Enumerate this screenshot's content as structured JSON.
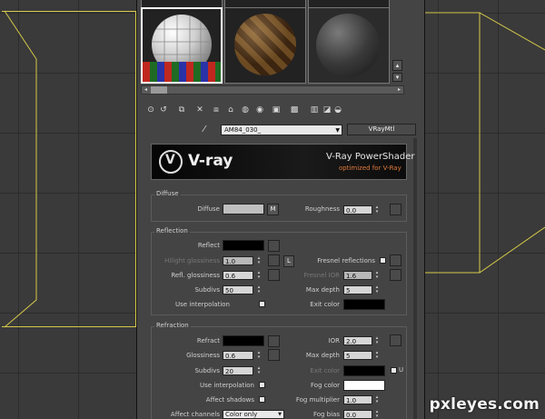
{
  "material": {
    "name": "AM84_030_",
    "type": "VRayMtl"
  },
  "banner": {
    "logo_text": "V-ray",
    "title": "V-Ray PowerShader",
    "subtitle": "optimized for V-Ray"
  },
  "diffuse": {
    "group_title": "Diffuse",
    "diffuse_label": "Diffuse",
    "map_button": "M",
    "roughness_label": "Roughness",
    "roughness_value": "0.0"
  },
  "reflection": {
    "group_title": "Reflection",
    "reflect_label": "Reflect",
    "hilight_label": "Hilight glossiness",
    "hilight_value": "1.0",
    "lock_button": "L",
    "fresnel_label": "Fresnel reflections",
    "refl_gloss_label": "Refl. glossiness",
    "refl_gloss_value": "0.6",
    "fresnel_ior_label": "Fresnel IOR",
    "fresnel_ior_value": "1.6",
    "subdivs_label": "Subdivs",
    "subdivs_value": "50",
    "max_depth_label": "Max depth",
    "max_depth_value": "5",
    "interp_label": "Use interpolation",
    "exit_color_label": "Exit color"
  },
  "refraction": {
    "group_title": "Refraction",
    "refract_label": "Refract",
    "ior_label": "IOR",
    "ior_value": "2.0",
    "gloss_label": "Glossiness",
    "gloss_value": "0.6",
    "max_depth_label": "Max depth",
    "max_depth_value": "5",
    "subdivs_label": "Subdivs",
    "subdivs_value": "20",
    "exit_color_label": "Exit color",
    "exit_u_label": "U",
    "interp_label": "Use interpolation",
    "fog_color_label": "Fog color",
    "affect_shadows_label": "Affect shadows",
    "fog_mult_label": "Fog multiplier",
    "fog_mult_value": "1.0",
    "affect_channels_label": "Affect channels",
    "affect_channels_value": "Color only",
    "fog_bias_label": "Fog bias",
    "fog_bias_value": "0.0"
  },
  "colors": {
    "viewport_bg": "#3a3a3a",
    "wireframe": "#d6c94a",
    "panel_bg": "#444444",
    "banner_accent": "#c0392b"
  },
  "watermark": "pxleyes.com"
}
